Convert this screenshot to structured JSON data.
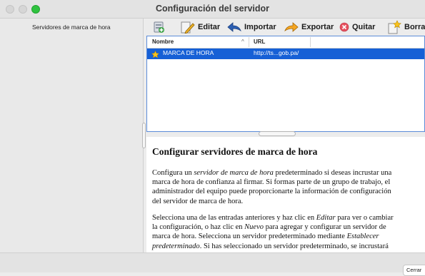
{
  "window": {
    "title": "Configuración del servidor"
  },
  "sidebar": {
    "items": [
      {
        "label": "Servidores de marca de hora"
      }
    ]
  },
  "toolbar": {
    "buttons": [
      {
        "label": "",
        "icon": "add-server-icon"
      },
      {
        "label": "Editar",
        "icon": "edit-icon"
      },
      {
        "label": "Importar",
        "icon": "import-arrow-icon"
      },
      {
        "label": "Exportar",
        "icon": "export-arrow-icon"
      },
      {
        "label": "Quitar",
        "icon": "remove-icon"
      },
      {
        "label": "Borrar",
        "icon": "clear-icon"
      }
    ]
  },
  "table": {
    "columns": [
      "Nombre",
      "URL"
    ],
    "sort_indicator": "^",
    "rows": [
      {
        "name": "MARCA DE HORA",
        "url": "http://ts...gob.pa/",
        "default_icon": "star-icon",
        "selected": true
      }
    ]
  },
  "help": {
    "title": "Configurar servidores de marca de hora",
    "p1_lines": [
      [
        "Configura un ",
        {
          "i": "servidor de marca de hora"
        },
        " predeterminado si deseas incrustar una"
      ],
      [
        "marca de hora de confianza al firmar. Si formas parte de un grupo de trabajo, el"
      ],
      [
        "administrador del equipo puede proporcionarte la información de configuración"
      ],
      [
        "del servidor de marca de hora."
      ]
    ],
    "p2_lines": [
      [
        "Selecciona una de las entradas anteriores y haz clic en ",
        {
          "i": "Editar"
        },
        " para ver o cambiar"
      ],
      [
        "la configuración, o haz clic en ",
        {
          "i": "Nuevo"
        },
        " para agregar y configurar un servidor de"
      ],
      [
        "marca de hora. Selecciona un servidor predeterminado mediante ",
        {
          "i": "Establecer"
        }
      ],
      [
        {
          "i": "predeterminado"
        },
        ". Si has seleccionado un servidor predeterminado, se incrustará"
      ]
    ]
  },
  "footer": {
    "close_label": "Cerrar"
  },
  "colors": {
    "selection": "#1660d6",
    "accent_border": "#5b8bd8"
  }
}
